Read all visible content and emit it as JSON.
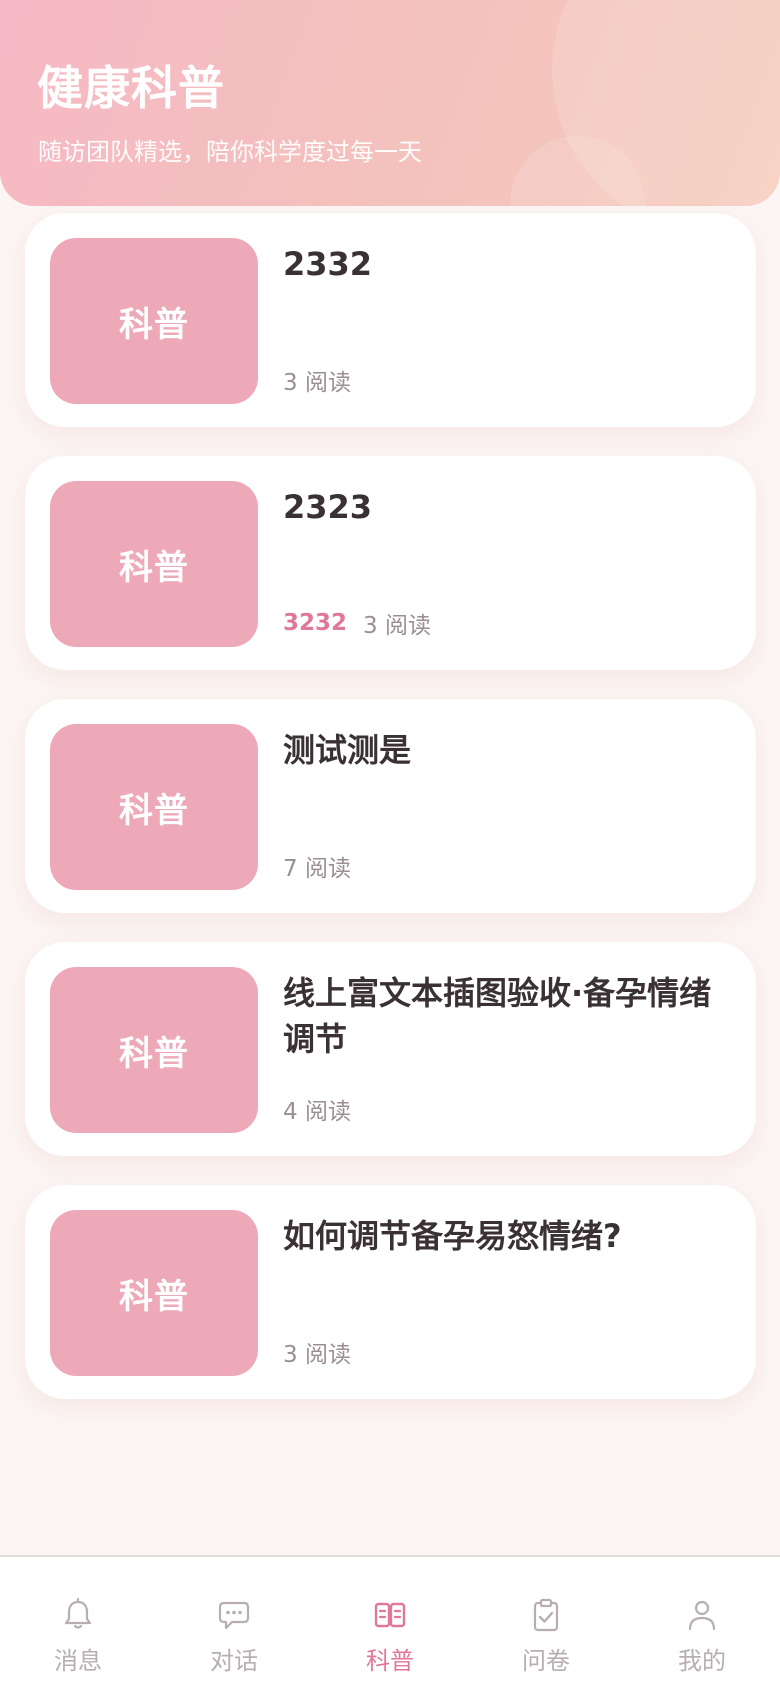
{
  "header": {
    "title": "健康科普",
    "subtitle": "随访团队精选，陪你科学度过每一天"
  },
  "articles": [
    {
      "thumb_label": "科普",
      "title": "2332",
      "tag": "",
      "reads": "3 阅读"
    },
    {
      "thumb_label": "科普",
      "title": "2323",
      "tag": "3232",
      "reads": "3 阅读"
    },
    {
      "thumb_label": "科普",
      "title": "测试测是",
      "tag": "",
      "reads": "7 阅读"
    },
    {
      "thumb_label": "科普",
      "title": "线上富文本插图验收·备孕情绪调节",
      "tag": "",
      "reads": "4 阅读"
    },
    {
      "thumb_label": "科普",
      "title": "如何调节备孕易怒情绪?",
      "tag": "",
      "reads": "3 阅读"
    }
  ],
  "tabbar": {
    "items": [
      {
        "label": "消息",
        "icon": "bell-icon",
        "active": false
      },
      {
        "label": "对话",
        "icon": "chat-bubble-icon",
        "active": false
      },
      {
        "label": "科普",
        "icon": "book-open-icon",
        "active": true
      },
      {
        "label": "问卷",
        "icon": "clipboard-check-icon",
        "active": false
      },
      {
        "label": "我的",
        "icon": "user-icon",
        "active": false
      }
    ]
  },
  "colors": {
    "accent": "#e0789a",
    "thumb": "#eea9b8",
    "inactive": "#b8aeaf",
    "title_text": "#3a3134"
  }
}
